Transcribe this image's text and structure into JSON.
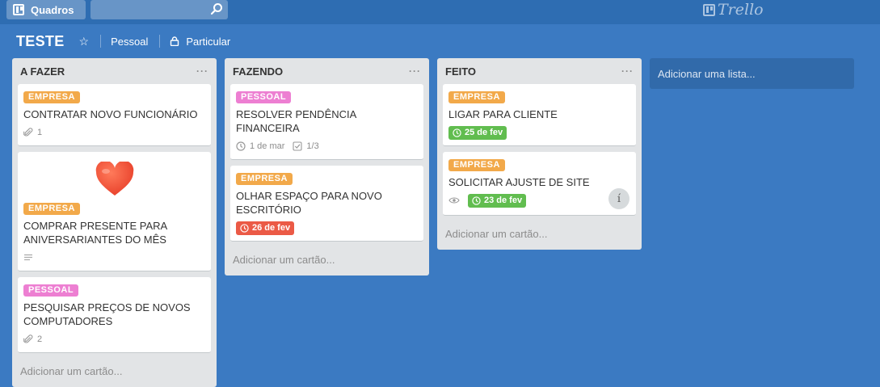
{
  "colors": {
    "background": "#3b7ac2",
    "label_empresa": "#f2a94a",
    "label_pessoal": "#ed7fd2",
    "due_overdue": "#eb5a46",
    "due_complete": "#61bd4f"
  },
  "topbar": {
    "boards_label": "Quadros",
    "search_value": "",
    "logo_text": "Trello"
  },
  "board": {
    "title": "TESTE",
    "team": "Pessoal",
    "privacy": "Particular"
  },
  "lists": [
    {
      "title": "A FAZER",
      "menu": "···",
      "add_card": "Adicionar um cartão...",
      "cards": [
        {
          "label": "EMPRESA",
          "title": "CONTRATAR NOVO FUNCIONÁRIO",
          "attachments": "1"
        },
        {
          "cover": "heart",
          "label": "EMPRESA",
          "title": "COMPRAR PRESENTE PARA ANIVERSARIANTES DO MÊS"
        },
        {
          "label": "PESSOAL",
          "title": "PESQUISAR PREÇOS DE NOVOS COMPUTADORES",
          "attachments": "2"
        }
      ]
    },
    {
      "title": "FAZENDO",
      "menu": "···",
      "add_card": "Adicionar um cartão...",
      "cards": [
        {
          "label": "PESSOAL",
          "title": "RESOLVER PENDÊNCIA FINANCEIRA",
          "due": "1 de mar",
          "checklist": "1/3"
        },
        {
          "label": "EMPRESA",
          "title": "OLHAR ESPAÇO PARA NOVO ESCRITÓRIO",
          "due": "26 de fev"
        }
      ]
    },
    {
      "title": "FEITO",
      "menu": "···",
      "add_card": "Adicionar um cartão...",
      "cards": [
        {
          "label": "EMPRESA",
          "title": "LIGAR PARA CLIENTE",
          "due": "25 de fev"
        },
        {
          "label": "EMPRESA",
          "title": "SOLICITAR AJUSTE DE SITE",
          "due": "23 de fev",
          "member_initial": "í"
        }
      ]
    }
  ],
  "add_list": "Adicionar uma lista..."
}
